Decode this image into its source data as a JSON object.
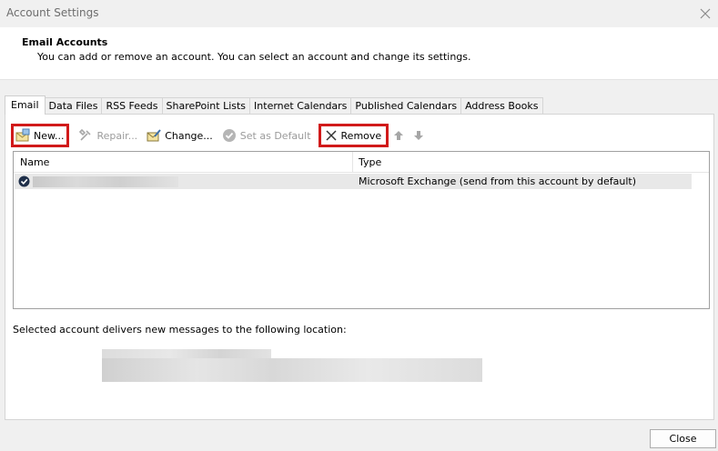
{
  "window": {
    "title": "Account Settings"
  },
  "header": {
    "title": "Email Accounts",
    "description": "You can add or remove an account. You can select an account and change its settings."
  },
  "tabs": [
    {
      "label": "Email",
      "active": true
    },
    {
      "label": "Data Files"
    },
    {
      "label": "RSS Feeds"
    },
    {
      "label": "SharePoint Lists"
    },
    {
      "label": "Internet Calendars"
    },
    {
      "label": "Published Calendars"
    },
    {
      "label": "Address Books"
    }
  ],
  "toolbar": {
    "new_label": "New...",
    "repair_label": "Repair...",
    "change_label": "Change...",
    "set_default_label": "Set as Default",
    "remove_label": "Remove"
  },
  "accounts": {
    "columns": {
      "name": "Name",
      "type": "Type"
    },
    "rows": [
      {
        "type": "Microsoft Exchange (send from this account by default)"
      }
    ]
  },
  "delivery": {
    "label": "Selected account delivers new messages to the following location:"
  },
  "footer": {
    "close_label": "Close"
  },
  "colors": {
    "highlight": "#d11a1a",
    "selection": "#e8e8e8"
  },
  "icons": [
    "close-icon",
    "new-account-icon",
    "repair-icon",
    "change-icon",
    "set-default-icon",
    "remove-icon",
    "move-up-icon",
    "move-down-icon",
    "default-account-check-icon"
  ]
}
